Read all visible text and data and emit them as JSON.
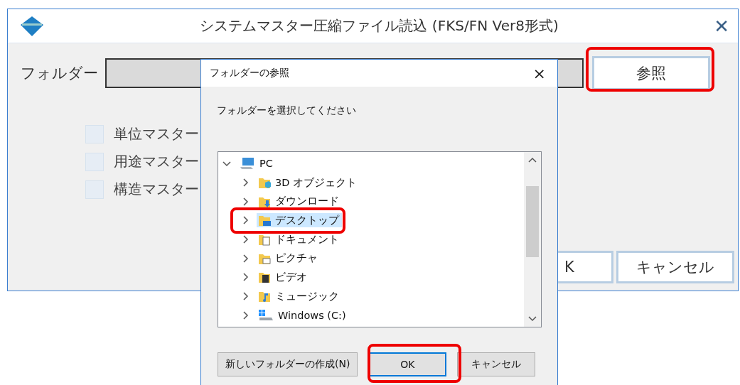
{
  "main_window": {
    "title": "システムマスター圧縮ファイル読込 (FKS/FN Ver8形式)",
    "close": "✕",
    "folder_label": "フォルダー",
    "browse_button": "参照",
    "checkboxes": [
      {
        "label": "単位マスター",
        "checked": false
      },
      {
        "label": "用途マスター",
        "checked": false
      },
      {
        "label": "構造マスター",
        "checked": false
      }
    ],
    "buttons": [
      "K",
      "キャンセル"
    ]
  },
  "dialog": {
    "title": "フォルダーの参照",
    "close": "×",
    "instruction": "フォルダーを選択してください",
    "tree": [
      {
        "label": "PC",
        "kind": "pc",
        "expanded": true,
        "selected": false,
        "children": [
          {
            "label": "3D オブジェクト",
            "kind": "objects",
            "expanded": false,
            "selected": false
          },
          {
            "label": "ダウンロード",
            "kind": "download",
            "expanded": false,
            "selected": false
          },
          {
            "label": "デスクトップ",
            "kind": "desktop",
            "expanded": false,
            "selected": true
          },
          {
            "label": "ドキュメント",
            "kind": "documents",
            "expanded": false,
            "selected": false
          },
          {
            "label": "ピクチャ",
            "kind": "pictures",
            "expanded": false,
            "selected": false
          },
          {
            "label": "ビデオ",
            "kind": "videos",
            "expanded": false,
            "selected": false
          },
          {
            "label": "ミュージック",
            "kind": "music",
            "expanded": false,
            "selected": false
          },
          {
            "label": "Windows (C:)",
            "kind": "drive",
            "expanded": false,
            "selected": false
          }
        ]
      }
    ],
    "buttons": [
      {
        "label": "新しいフォルダーの作成(N)",
        "focused": false
      },
      {
        "label": "OK",
        "focused": true
      },
      {
        "label": "キャンセル",
        "focused": false
      }
    ]
  }
}
